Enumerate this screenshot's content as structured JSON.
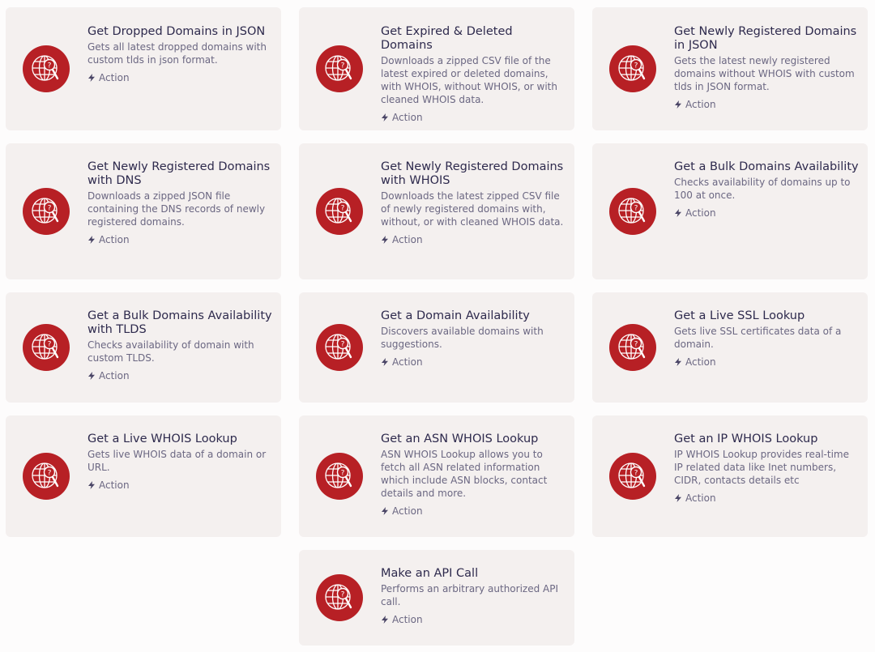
{
  "colors": {
    "card_bg": "#f4f0ef",
    "icon_bg": "#b72025",
    "title": "#2e2a4d",
    "desc": "#6b6782"
  },
  "cards": [
    {
      "title": "Get Dropped Domains in JSON",
      "desc": "Gets all latest dropped domains with custom tlds in json format.",
      "action": "Action",
      "icon": "globe-question-icon"
    },
    {
      "title": "Get Expired & Deleted Domains",
      "desc": "Downloads a zipped CSV file of the latest expired or deleted domains, with WHOIS, without WHOIS, or with cleaned WHOIS data.",
      "action": "Action",
      "icon": "globe-question-icon"
    },
    {
      "title": "Get Newly Registered Domains in JSON",
      "desc": "Gets the latest newly registered domains without WHOIS with custom tlds in JSON format.",
      "action": "Action",
      "icon": "globe-question-icon"
    },
    {
      "title": "Get Newly Registered Domains with DNS",
      "desc": "Downloads a zipped JSON file containing the DNS records of newly registered domains.",
      "action": "Action",
      "icon": "globe-question-icon"
    },
    {
      "title": "Get Newly Registered Domains with WHOIS",
      "desc": "Downloads the latest zipped CSV file of newly registered domains with, without, or with cleaned WHOIS data.",
      "action": "Action",
      "icon": "globe-question-icon"
    },
    {
      "title": "Get a Bulk Domains Availability",
      "desc": "Checks availability of domains up to 100 at once.",
      "action": "Action",
      "icon": "globe-question-icon"
    },
    {
      "title": "Get a Bulk Domains Availability with TLDS",
      "desc": "Checks availability of domain with custom TLDS.",
      "action": "Action",
      "icon": "globe-question-icon"
    },
    {
      "title": "Get a Domain Availability",
      "desc": "Discovers available domains with suggestions.",
      "action": "Action",
      "icon": "globe-question-icon"
    },
    {
      "title": "Get a Live SSL Lookup",
      "desc": "Gets live SSL certificates data of a domain.",
      "action": "Action",
      "icon": "globe-question-icon"
    },
    {
      "title": "Get a Live WHOIS Lookup",
      "desc": "Gets live WHOIS data of a domain or URL.",
      "action": "Action",
      "icon": "globe-question-icon"
    },
    {
      "title": "Get an ASN WHOIS Lookup",
      "desc": "ASN WHOIS Lookup allows you to fetch all ASN related information which include ASN blocks, contact details and more.",
      "action": "Action",
      "icon": "globe-question-icon"
    },
    {
      "title": "Get an IP WHOIS Lookup",
      "desc": "IP WHOIS Lookup provides real-time IP related data like Inet numbers, CIDR, contacts details etc",
      "action": "Action",
      "icon": "globe-question-icon"
    },
    {
      "title": "Make an API Call",
      "desc": "Performs an arbitrary authorized API call.",
      "action": "Action",
      "icon": "globe-question-icon"
    }
  ]
}
